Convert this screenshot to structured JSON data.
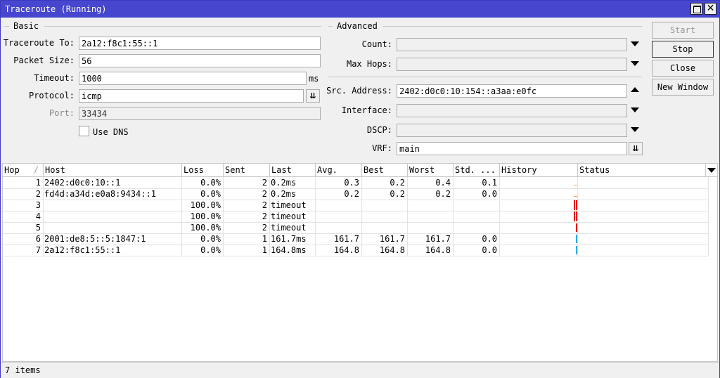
{
  "window": {
    "title": "Traceroute (Running)"
  },
  "basic": {
    "section_label": "Basic",
    "traceroute_to_label": "Traceroute To:",
    "traceroute_to_value": "2a12:f8c1:55::1",
    "packet_size_label": "Packet Size:",
    "packet_size_value": "56",
    "timeout_label": "Timeout:",
    "timeout_value": "1000",
    "timeout_unit": "ms",
    "protocol_label": "Protocol:",
    "protocol_value": "icmp",
    "port_label": "Port:",
    "port_value": "33434",
    "use_dns_label": "Use DNS",
    "use_dns_checked": false
  },
  "advanced": {
    "section_label": "Advanced",
    "count_label": "Count:",
    "count_value": "",
    "max_hops_label": "Max Hops:",
    "max_hops_value": "",
    "src_address_label": "Src. Address:",
    "src_address_value": "2402:d0c0:10:154::a3aa:e0fc",
    "interface_label": "Interface:",
    "interface_value": "",
    "dscp_label": "DSCP:",
    "dscp_value": "",
    "vrf_label": "VRF:",
    "vrf_value": "main"
  },
  "buttons": {
    "start": "Start",
    "stop": "Stop",
    "close": "Close",
    "new_window": "New Window"
  },
  "table": {
    "columns": [
      "Hop",
      "Host",
      "Loss",
      "Sent",
      "Last",
      "Avg.",
      "Best",
      "Worst",
      "Std. ...",
      "History",
      "Status"
    ],
    "rows": [
      {
        "hop": "1",
        "host": "2402:d0c0:10::1",
        "loss": "0.0%",
        "sent": "2",
        "last": "0.2ms",
        "avg": "0.3",
        "best": "0.2",
        "worst": "0.4",
        "std": "0.1",
        "history": "low",
        "history_color": "#f0a060"
      },
      {
        "hop": "2",
        "host": "fd4d:a34d:e0a8:9434::1",
        "loss": "0.0%",
        "sent": "2",
        "last": "0.2ms",
        "avg": "0.2",
        "best": "0.2",
        "worst": "0.2",
        "std": "0.0",
        "history": "low",
        "history_color": "#f0a060"
      },
      {
        "hop": "3",
        "host": "",
        "loss": "100.0%",
        "sent": "2",
        "last": "timeout",
        "avg": "",
        "best": "",
        "worst": "",
        "std": "",
        "history": "double",
        "history_color": "#e01010"
      },
      {
        "hop": "4",
        "host": "",
        "loss": "100.0%",
        "sent": "2",
        "last": "timeout",
        "avg": "",
        "best": "",
        "worst": "",
        "std": "",
        "history": "double",
        "history_color": "#e01010"
      },
      {
        "hop": "5",
        "host": "",
        "loss": "100.0%",
        "sent": "2",
        "last": "timeout",
        "avg": "",
        "best": "",
        "worst": "",
        "std": "",
        "history": "single",
        "history_color": "#e01010"
      },
      {
        "hop": "6",
        "host": "2001:de8:5::5:1847:1",
        "loss": "0.0%",
        "sent": "1",
        "last": "161.7ms",
        "avg": "161.7",
        "best": "161.7",
        "worst": "161.7",
        "std": "0.0",
        "history": "single",
        "history_color": "#30a8e0"
      },
      {
        "hop": "7",
        "host": "2a12:f8c1:55::1",
        "loss": "0.0%",
        "sent": "1",
        "last": "164.8ms",
        "avg": "164.8",
        "best": "164.8",
        "worst": "164.8",
        "std": "0.0",
        "history": "single",
        "history_color": "#30a8e0"
      }
    ]
  },
  "status": {
    "items_text": "7 items"
  },
  "icons": {
    "maximize": "maximize-icon",
    "close": "close-icon",
    "dropdown": "chevron-down-icon",
    "collapse": "chevron-up-icon",
    "sort": "sort-icon"
  }
}
